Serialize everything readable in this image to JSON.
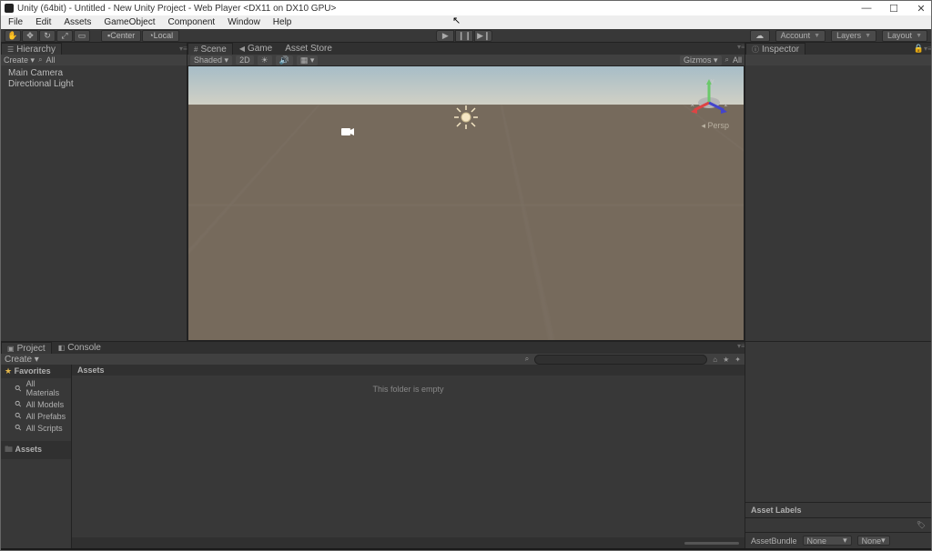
{
  "window": {
    "title": "Unity (64bit) - Untitled - New Unity Project - Web Player <DX11 on DX10 GPU>",
    "buttons": {
      "min": "—",
      "max": "☐",
      "close": "✕"
    }
  },
  "menubar": [
    "File",
    "Edit",
    "Assets",
    "GameObject",
    "Component",
    "Window",
    "Help"
  ],
  "toolbar": {
    "pivot": "Center",
    "handle": "Local",
    "account": "Account",
    "layers": "Layers",
    "layout": "Layout"
  },
  "hierarchy": {
    "tab": "Hierarchy",
    "create": "Create",
    "searchAll": "All",
    "items": [
      "Main Camera",
      "Directional Light"
    ]
  },
  "center": {
    "tabs": {
      "scene": "Scene",
      "game": "Game",
      "asset_store": "Asset Store"
    },
    "sub": {
      "shaded": "Shaded",
      "mode2d": "2D",
      "gizmos": "Gizmos",
      "all": "All"
    },
    "persp": "Persp",
    "axes": {
      "x": "x",
      "y": "y",
      "z": "z"
    }
  },
  "inspector": {
    "tab": "Inspector"
  },
  "project": {
    "tabs": {
      "project": "Project",
      "console": "Console"
    },
    "create": "Create",
    "tree": {
      "favorites": "Favorites",
      "fav_items": [
        "All Materials",
        "All Models",
        "All Prefabs",
        "All Scripts"
      ],
      "assets": "Assets"
    },
    "path": "Assets",
    "empty": "This folder is empty"
  },
  "insp_bottom": {
    "labels": "Asset Labels",
    "bundle": "AssetBundle",
    "none": "None"
  }
}
